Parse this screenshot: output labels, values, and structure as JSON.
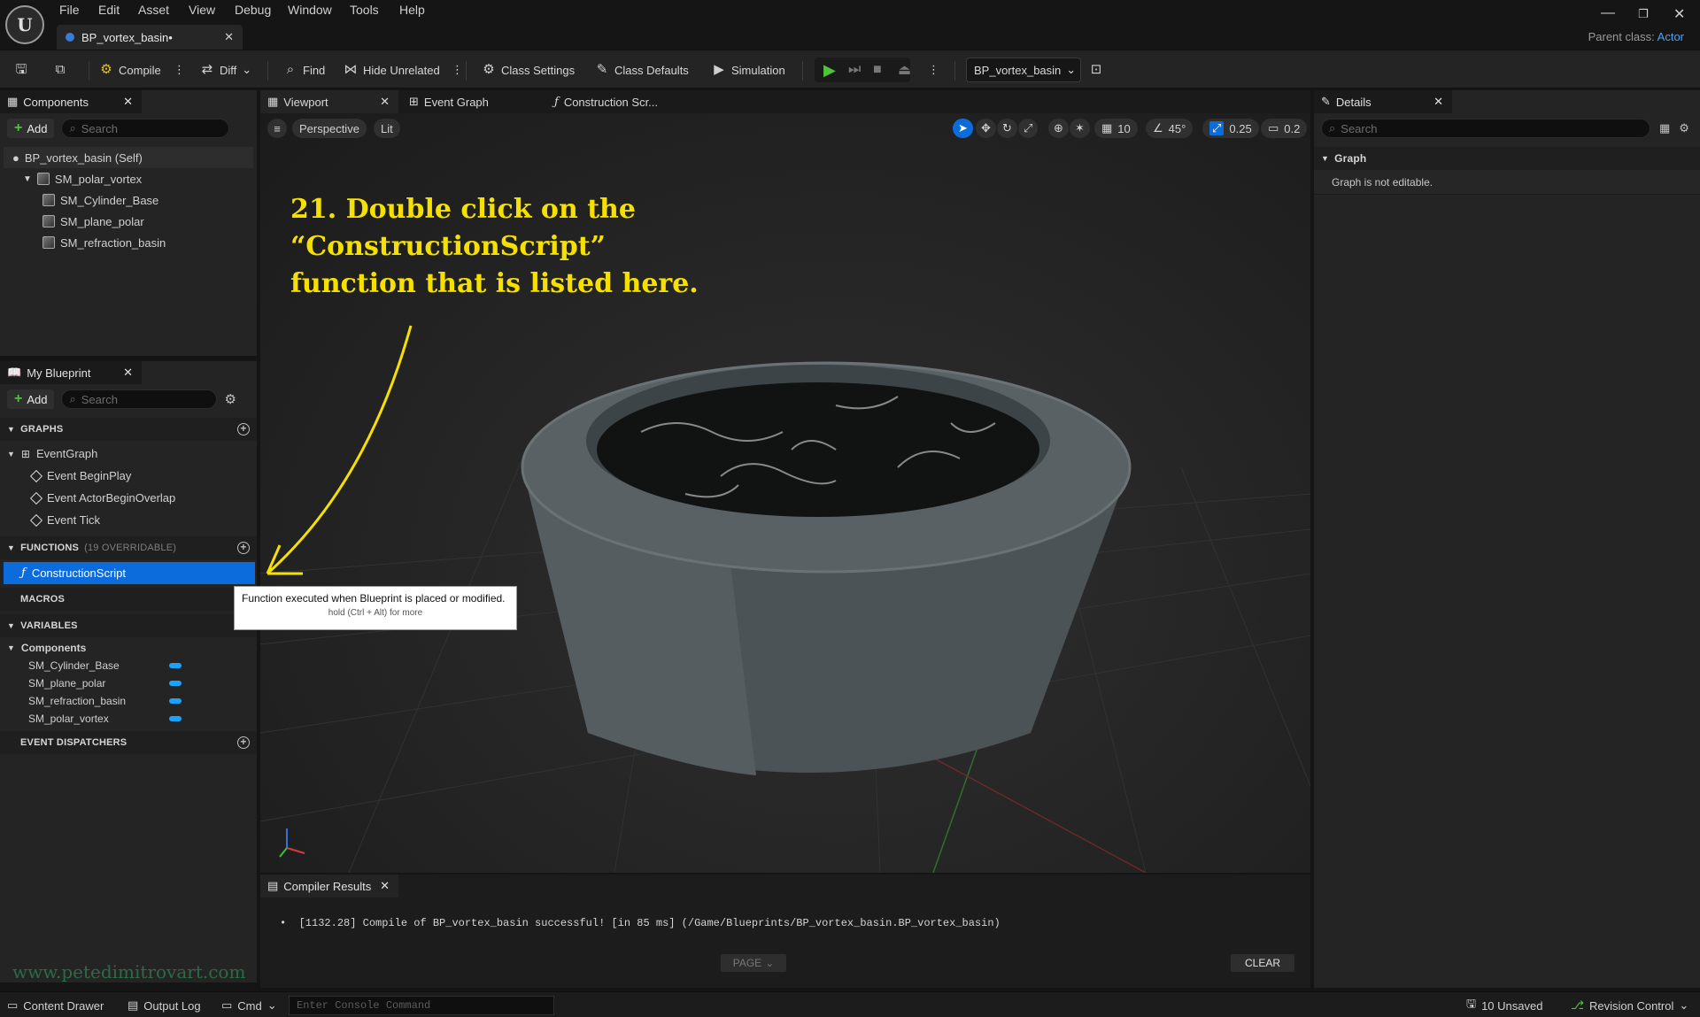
{
  "menu": [
    "File",
    "Edit",
    "Asset",
    "View",
    "Debug",
    "Window",
    "Tools",
    "Help"
  ],
  "doc_tab": {
    "label": "BP_vortex_basin•"
  },
  "parent_class": {
    "label": "Parent class:",
    "value": "Actor"
  },
  "toolbar": {
    "compile": "Compile",
    "diff": "Diff",
    "find": "Find",
    "hide_unrelated": "Hide Unrelated",
    "class_settings": "Class Settings",
    "class_defaults": "Class Defaults",
    "simulation": "Simulation",
    "debug_object": "BP_vortex_basin"
  },
  "components": {
    "tab": "Components",
    "add": "Add",
    "search_placeholder": "Search",
    "tree": [
      "BP_vortex_basin (Self)",
      "SM_polar_vortex",
      "SM_Cylinder_Base",
      "SM_plane_polar",
      "SM_refraction_basin"
    ]
  },
  "my_blueprint": {
    "tab": "My Blueprint",
    "add": "Add",
    "search_placeholder": "Search",
    "graphs_header": "GRAPHS",
    "event_graph": "EventGraph",
    "events": [
      "Event BeginPlay",
      "Event ActorBeginOverlap",
      "Event Tick"
    ],
    "functions_header": "FUNCTIONS",
    "functions_sub": "(19 OVERRIDABLE)",
    "construction_script": "ConstructionScript",
    "macros_header": "MACROS",
    "variables_header": "VARIABLES",
    "components_cat": "Components",
    "variables": [
      "SM_Cylinder_Base",
      "SM_plane_polar",
      "SM_refraction_basin",
      "SM_polar_vortex"
    ],
    "dispatchers_header": "EVENT DISPATCHERS"
  },
  "tooltip": {
    "text": "Function executed when Blueprint is placed or modified.",
    "hint": "hold (Ctrl + Alt) for more"
  },
  "viewport": {
    "tabs": [
      "Viewport",
      "Event Graph",
      "Construction Scr..."
    ],
    "perspective": "Perspective",
    "lit": "Lit",
    "grid_snap": "10",
    "rot_snap": "45°",
    "scale_snap": "0.25",
    "cam_speed": "0.2"
  },
  "annotation": {
    "line1": "21. Double click on the",
    "line2": "“ConstructionScript”",
    "line3": "function that is listed here."
  },
  "compiler": {
    "tab": "Compiler Results",
    "message": "[1132.28] Compile of BP_vortex_basin successful! [in 85 ms] (/Game/Blueprints/BP_vortex_basin.BP_vortex_basin)",
    "page": "PAGE",
    "clear": "CLEAR"
  },
  "details": {
    "tab": "Details",
    "search_placeholder": "Search",
    "section": "Graph",
    "message": "Graph is not editable."
  },
  "statusbar": {
    "content_drawer": "Content Drawer",
    "output_log": "Output Log",
    "cmd": "Cmd",
    "console_placeholder": "Enter Console Command",
    "unsaved": "10 Unsaved",
    "revision_control": "Revision Control"
  },
  "watermark": "www.petedimitrovart.com",
  "colors": {
    "accent": "#0d6cdb",
    "annotation": "#f5e000",
    "play": "#52c23a",
    "variable": "#18a3ff"
  }
}
